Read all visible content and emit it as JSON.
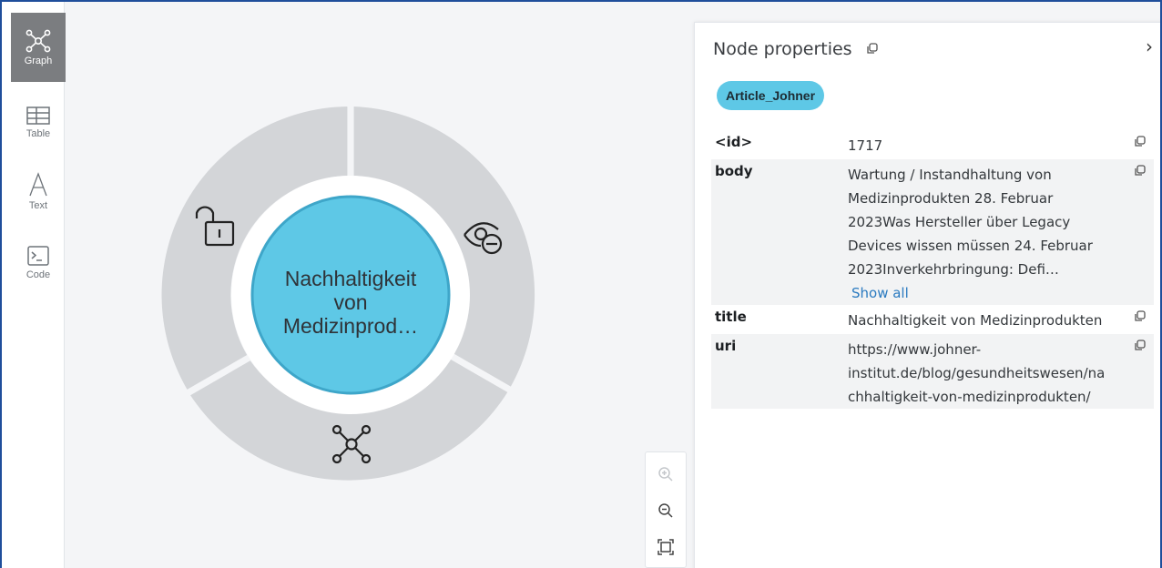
{
  "sidebar": {
    "items": [
      {
        "label": "Graph",
        "icon": "graph-icon",
        "active": true
      },
      {
        "label": "Table",
        "icon": "table-icon",
        "active": false
      },
      {
        "label": "Text",
        "icon": "text-icon",
        "active": false
      },
      {
        "label": "Code",
        "icon": "code-icon",
        "active": false
      }
    ]
  },
  "graph": {
    "node_caption_lines": [
      "Nachhaltigkeit",
      "von",
      "Medizinprod…"
    ],
    "node_color": "#5ec8e6",
    "ring_color": "#d3d5d8",
    "ring_actions": [
      "unlock-icon",
      "hide-icon",
      "expand-icon"
    ]
  },
  "zoom_controls": [
    "zoom-in-icon",
    "zoom-out-icon",
    "fit-icon"
  ],
  "panel": {
    "title": "Node properties",
    "label": "Article_Johner",
    "show_all": "Show all",
    "properties": [
      {
        "key": "<id>",
        "lines": [
          "1717"
        ]
      },
      {
        "key": "body",
        "lines": [
          "Wartung / Instandhaltung von",
          "Medizinprodukten 28. Februar",
          "2023Was Hersteller über Legacy",
          "Devices wissen müssen 24. Februar",
          "2023Inverkehrbringung: Defi…"
        ]
      },
      {
        "key": "title",
        "lines": [
          "Nachhaltigkeit von Medizinprodukten"
        ]
      },
      {
        "key": "uri",
        "lines": [
          "https://www.johner-",
          "institut.de/blog/gesundheitswesen/na",
          "chhaltigkeit-von-medizinprodukten/"
        ]
      }
    ]
  }
}
